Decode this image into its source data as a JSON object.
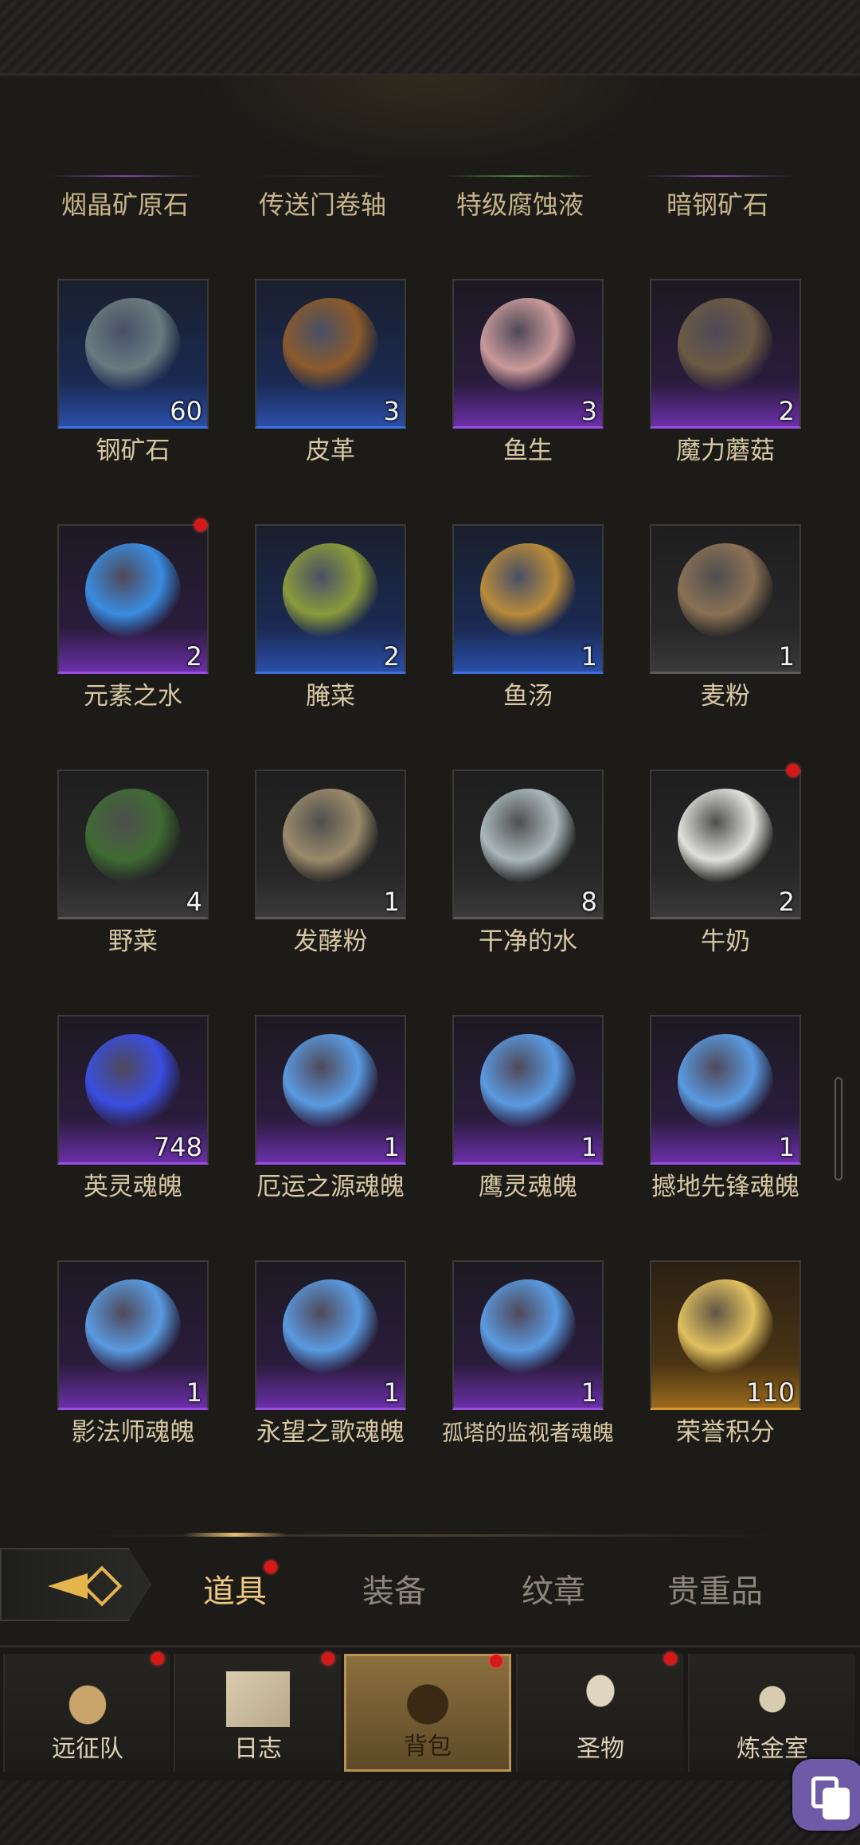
{
  "top_items": [
    {
      "label": "烟晶矿原石",
      "line_color": "#7a4bb0"
    },
    {
      "label": "传送门卷轴",
      "line_color": "#2a2a2a"
    },
    {
      "label": "特级腐蚀液",
      "line_color": "#4c8f3a"
    },
    {
      "label": "暗钢矿石",
      "line_color": "#7a4bb0"
    }
  ],
  "items": [
    {
      "name": "钢矿石",
      "count": "60",
      "quality": "blue",
      "icon": "steel-ore-icon",
      "art_color": "#6a7a80"
    },
    {
      "name": "皮革",
      "count": "3",
      "quality": "blue",
      "icon": "leather-icon",
      "art_color": "#8b5a2b"
    },
    {
      "name": "鱼生",
      "count": "3",
      "quality": "purple",
      "icon": "raw-fish-icon",
      "art_color": "#c99a9a"
    },
    {
      "name": "魔力蘑菇",
      "count": "2",
      "quality": "purple",
      "icon": "magic-mushroom-icon",
      "art_color": "#6b5a44"
    },
    {
      "name": "元素之水",
      "count": "2",
      "quality": "purple",
      "icon": "elemental-water-icon",
      "art_color": "#3a8ce0",
      "dot": true
    },
    {
      "name": "腌菜",
      "count": "2",
      "quality": "blue",
      "icon": "pickles-jar-icon",
      "art_color": "#8a9a3a"
    },
    {
      "name": "鱼汤",
      "count": "1",
      "quality": "blue",
      "icon": "fish-soup-icon",
      "art_color": "#b88a3a"
    },
    {
      "name": "麦粉",
      "count": "1",
      "quality": "gray",
      "icon": "flour-sack-icon",
      "art_color": "#8a7055"
    },
    {
      "name": "野菜",
      "count": "4",
      "quality": "gray",
      "icon": "wild-greens-icon",
      "art_color": "#3f6a33"
    },
    {
      "name": "发酵粉",
      "count": "1",
      "quality": "gray",
      "icon": "yeast-powder-icon",
      "art_color": "#9a8a6a"
    },
    {
      "name": "干净的水",
      "count": "8",
      "quality": "gray",
      "icon": "clean-water-icon",
      "art_color": "#aab8bc"
    },
    {
      "name": "牛奶",
      "count": "2",
      "quality": "gray",
      "icon": "milk-bottle-icon",
      "art_color": "#e0e0dc",
      "dot": true
    },
    {
      "name": "英灵魂魄",
      "count": "748",
      "quality": "purple",
      "icon": "hero-soul-crystal-icon",
      "art_color": "#3a4ee0"
    },
    {
      "name": "厄运之源魂魄",
      "count": "1",
      "quality": "purple",
      "icon": "soul-crystal-icon",
      "art_color": "#5a9ae0"
    },
    {
      "name": "鹰灵魂魄",
      "count": "1",
      "quality": "purple",
      "icon": "soul-crystal-icon",
      "art_color": "#5a9ae0"
    },
    {
      "name": "撼地先锋魂魄",
      "count": "1",
      "quality": "purple",
      "icon": "soul-crystal-icon",
      "art_color": "#5a9ae0"
    },
    {
      "name": "影法师魂魄",
      "count": "1",
      "quality": "purple",
      "icon": "soul-crystal-icon",
      "art_color": "#5a9ae0"
    },
    {
      "name": "永望之歌魂魄",
      "count": "1",
      "quality": "purple",
      "icon": "soul-crystal-icon",
      "art_color": "#5a9ae0"
    },
    {
      "name": "孤塔的监视者魂魄",
      "count": "1",
      "quality": "purple",
      "icon": "soul-crystal-icon",
      "art_color": "#5a9ae0",
      "small": true
    },
    {
      "name": "荣誉积分",
      "count": "110",
      "quality": "gold",
      "icon": "honor-star-icon",
      "art_color": "#e0c060"
    }
  ],
  "tabs": [
    {
      "label": "道具",
      "active": true,
      "dot": true
    },
    {
      "label": "装备",
      "active": false
    },
    {
      "label": "纹章",
      "active": false
    },
    {
      "label": "贵重品",
      "active": false
    }
  ],
  "nav": [
    {
      "label": "远征队",
      "icon": "viking-helmet-icon",
      "dot": true,
      "active": false
    },
    {
      "label": "日志",
      "icon": "journal-scroll-icon",
      "dot": true,
      "active": false
    },
    {
      "label": "背包",
      "icon": "backpack-icon",
      "dot": true,
      "active": true
    },
    {
      "label": "圣物",
      "icon": "relic-torch-icon",
      "dot": true,
      "active": false
    },
    {
      "label": "炼金室",
      "icon": "alchemy-icon",
      "dot": false,
      "active": false
    }
  ]
}
